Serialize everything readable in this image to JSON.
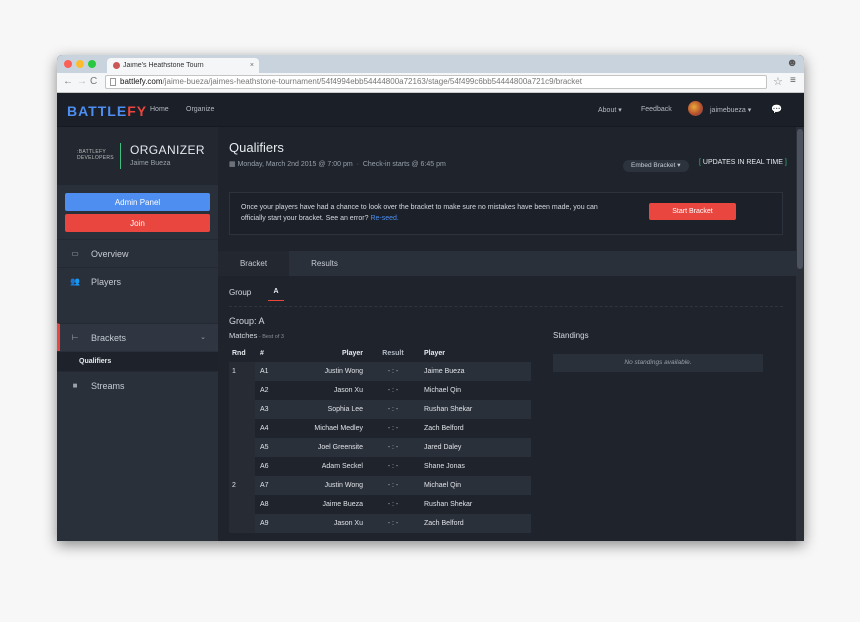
{
  "browser": {
    "tab_title": "Jaime's Heathstone Tourn",
    "tab_close": "×",
    "url_host": "battlefy.com",
    "url_path": "/jaime-bueza/jaimes-heathstone-tournament/54f4994ebb54444800a72163/stage/54f499c6bb54444800a721c9/bracket"
  },
  "nav": {
    "logo_part1": "BATTLE",
    "logo_part2": "FY",
    "links": [
      "Home",
      "Organize"
    ],
    "about": "About ▾",
    "feedback": "Feedback",
    "username": "jaimebueza ▾"
  },
  "sidebar": {
    "org_logo": ":BATTLEFY DEVELOPERS",
    "org_title": "ORGANIZER",
    "org_sub": "Jaime Bueza",
    "admin_btn": "Admin Panel",
    "join_btn": "Join",
    "items": [
      "Overview",
      "Players",
      "Brackets",
      "Streams"
    ],
    "sub_item": "Qualifiers"
  },
  "stage": {
    "title": "Qualifiers",
    "date": "Monday, March 2nd 2015  @  7:00 pm",
    "sep": "·",
    "checkin": "Check-in starts  @  6:45 pm",
    "embed": "Embed Bracket  ▾",
    "realtime": "UPDATES IN REAL TIME"
  },
  "notice": {
    "text": "Once your players have had a chance to look over the bracket to make sure no mistakes have been made, you can officially start your bracket. See an error?",
    "link": "Re-seed.",
    "start_btn": "Start Bracket"
  },
  "tabs": [
    "Bracket",
    "Results"
  ],
  "group": {
    "label": "Group",
    "active": "A",
    "heading": "Group: A",
    "matches_label": "Matches",
    "best_of": " - Best of 3",
    "standings_label": "Standings",
    "no_standings": "No standings available."
  },
  "table": {
    "headers": [
      "Rnd",
      "#",
      "Player",
      "Result",
      "Player"
    ],
    "rows": [
      {
        "rnd": "1",
        "id": "A1",
        "p1": "Justin Wong",
        "res": "- : -",
        "p2": "Jaime Bueza"
      },
      {
        "rnd": "",
        "id": "A2",
        "p1": "Jason Xu",
        "res": "- : -",
        "p2": "Michael Qin"
      },
      {
        "rnd": "",
        "id": "A3",
        "p1": "Sophia Lee",
        "res": "- : -",
        "p2": "Rushan Shekar"
      },
      {
        "rnd": "",
        "id": "A4",
        "p1": "Michael Medley",
        "res": "- : -",
        "p2": "Zach Belford"
      },
      {
        "rnd": "",
        "id": "A5",
        "p1": "Joel Greensite",
        "res": "- : -",
        "p2": "Jared Daley"
      },
      {
        "rnd": "",
        "id": "A6",
        "p1": "Adam Seckel",
        "res": "- : -",
        "p2": "Shane Jonas"
      },
      {
        "rnd": "2",
        "id": "A7",
        "p1": "Justin Wong",
        "res": "- : -",
        "p2": "Michael Qin"
      },
      {
        "rnd": "",
        "id": "A8",
        "p1": "Jaime Bueza",
        "res": "- : -",
        "p2": "Rushan Shekar"
      },
      {
        "rnd": "",
        "id": "A9",
        "p1": "Jason Xu",
        "res": "- : -",
        "p2": "Zach Belford"
      }
    ]
  }
}
